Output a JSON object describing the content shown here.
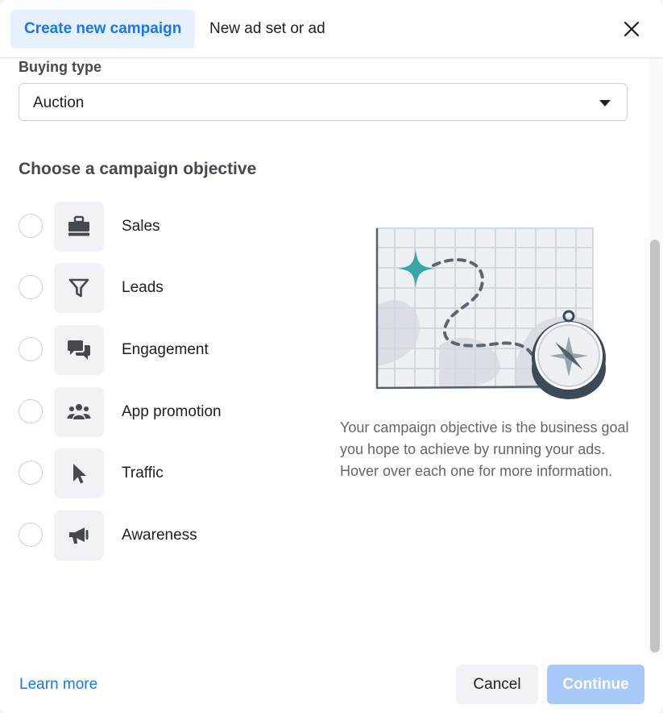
{
  "header": {
    "tabs": [
      {
        "label": "Create new campaign",
        "active": true
      },
      {
        "label": "New ad set or ad",
        "active": false
      }
    ],
    "close_icon": "close-icon"
  },
  "buying_type": {
    "label": "Buying type",
    "value": "Auction"
  },
  "objectives": {
    "title": "Choose a campaign objective",
    "items": [
      {
        "label": "Sales",
        "icon": "briefcase-icon"
      },
      {
        "label": "Leads",
        "icon": "funnel-icon"
      },
      {
        "label": "Engagement",
        "icon": "chat-bubbles-icon"
      },
      {
        "label": "App promotion",
        "icon": "people-icon"
      },
      {
        "label": "Traffic",
        "icon": "cursor-icon"
      },
      {
        "label": "Awareness",
        "icon": "megaphone-icon"
      }
    ],
    "description": "Your campaign objective is the business goal you hope to achieve by running your ads. Hover over each one for more information."
  },
  "footer": {
    "learn_more": "Learn more",
    "cancel": "Cancel",
    "continue": "Continue"
  },
  "colors": {
    "accent": "#1877f2",
    "accent_disabled": "#a9c9f8",
    "tab_active_bg": "#e7f0fd",
    "illustration_teal": "#3aa6a5"
  }
}
